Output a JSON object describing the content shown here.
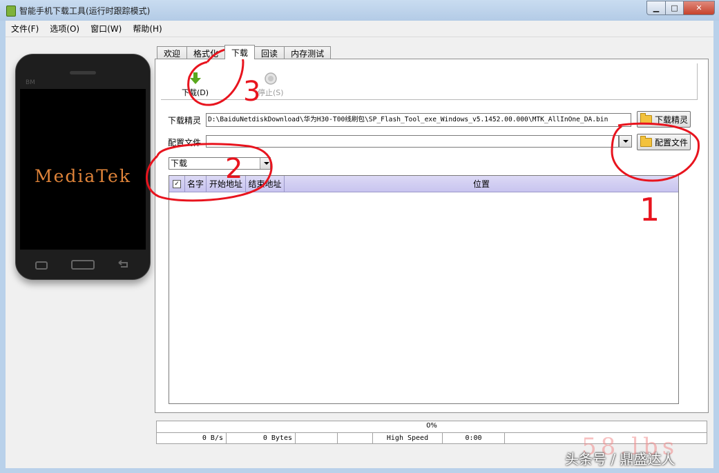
{
  "window": {
    "title": "智能手机下载工具(运行时跟踪模式)",
    "min_symbol": "▁",
    "max_symbol": "□",
    "close_symbol": "✕"
  },
  "menu": [
    "文件(F)",
    "选项(O)",
    "窗口(W)",
    "帮助(H)"
  ],
  "phone": {
    "brand": "BM",
    "logo": "MediaTek"
  },
  "tabs": [
    "欢迎",
    "格式化",
    "下载",
    "回读",
    "内存测试"
  ],
  "toolbar": {
    "download_label": "下载(D)",
    "stop_label": "停止(S)"
  },
  "download_agent": {
    "label": "下载精灵",
    "path": "D:\\BaiduNetdiskDownload\\华为H30-T00线刷包\\SP_Flash_Tool_exe_Windows_v5.1452.00.000\\MTK_AllInOne_DA.bin",
    "button": "下载精灵"
  },
  "scatter": {
    "label": "配置文件",
    "value": "",
    "button": "配置文件"
  },
  "mode_select": {
    "value": "下载"
  },
  "table": {
    "checkbox": "✓",
    "columns": [
      "名字",
      "开始地址",
      "结束地址",
      "位置"
    ],
    "rows": []
  },
  "status": {
    "progress_text": "0%",
    "progress": 0,
    "speed": "0 B/s",
    "bytes": "0 Bytes",
    "usb_mode": "High Speed",
    "time": "0:00"
  },
  "annotations": [
    "3",
    "2",
    "1"
  ],
  "watermark": {
    "faint": "58.lbs",
    "source": "头条号 / 鼎盛达人"
  },
  "colors": {
    "annotation": "#e8141e",
    "title_bg": "#c2d6ed",
    "grid_header": "#cfcbf2",
    "folder": "#f3c23d",
    "download_arrow": "#5aa81e"
  }
}
